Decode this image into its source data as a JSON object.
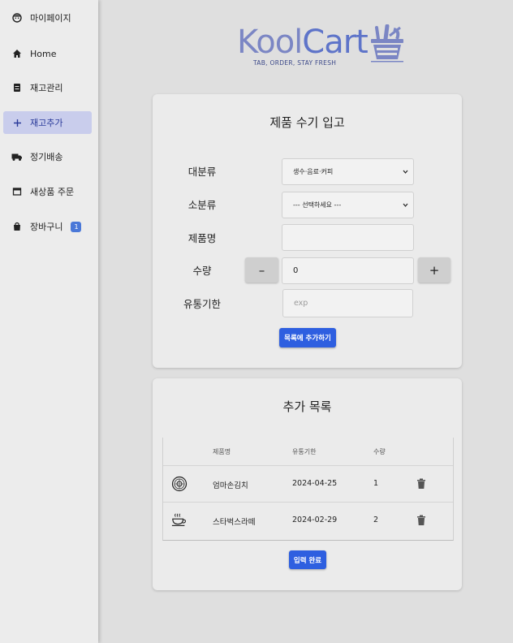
{
  "sidebar": {
    "items": [
      {
        "label": "마이페이지",
        "icon": "face-icon"
      },
      {
        "label": "Home",
        "icon": "home-icon"
      },
      {
        "label": "재고관리",
        "icon": "inventory-icon"
      },
      {
        "label": "재고추가",
        "icon": "plus-icon",
        "active": true
      },
      {
        "label": "정기배송",
        "icon": "truck-icon"
      },
      {
        "label": "새상품 주문",
        "icon": "store-icon"
      },
      {
        "label": "장바구니",
        "icon": "bag-icon",
        "badge": "1"
      }
    ]
  },
  "logo": {
    "text_part1": "Kool",
    "text_part2": "Cart",
    "tagline": "TAB, ORDER, STAY FRESH"
  },
  "form": {
    "title": "제품 수기 입고",
    "category_label": "대분류",
    "category_value": "생수·음료·커피",
    "subcategory_label": "소분류",
    "subcategory_value": "--- 선택하세요 ---",
    "name_label": "제품명",
    "name_value": "",
    "qty_label": "수량",
    "qty_value": "0",
    "minus_label": "–",
    "plus_label": "+",
    "expiry_label": "유통기한",
    "expiry_placeholder": "exp",
    "add_button": "목록에 추가하기"
  },
  "list": {
    "title": "추가 목록",
    "headers": [
      "제품명",
      "유통기한",
      "수량"
    ],
    "rows": [
      {
        "icon": "coin-icon",
        "name": "엄마손김치",
        "expiry": "2024-04-25",
        "qty": "1"
      },
      {
        "icon": "coffee-cup-icon",
        "name": "스타벅스라떼",
        "expiry": "2024-02-29",
        "qty": "2"
      }
    ],
    "submit_button": "입력 완료"
  },
  "colors": {
    "accent": "#2e5fe0",
    "sidebar_active_bg": "#c9cdec",
    "logo_primary": "#5e74c9"
  }
}
